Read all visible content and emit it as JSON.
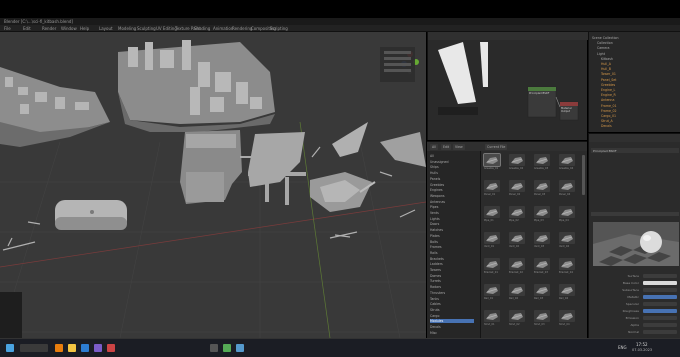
{
  "window": {
    "title": "Blender [C:\\...\\sci-fi_kitbash.blend]"
  },
  "menus": [
    "File",
    "Edit",
    "Render",
    "Window",
    "Help",
    "Layout",
    "Modeling",
    "Sculpting",
    "UV Editing",
    "Texture Paint",
    "Shading",
    "Animation",
    "Rendering",
    "Compositing",
    "Scripting"
  ],
  "viewport": {
    "header_buttons": [
      "Object Mode",
      "View",
      "Select",
      "Add",
      "Object"
    ]
  },
  "node_editor": {
    "tabs": [
      "Object",
      "View",
      "Select",
      "Add",
      "Node"
    ],
    "node_labels": [
      "Principled BSDF",
      "Material Output"
    ]
  },
  "asset_browser": {
    "tabs": [
      "All",
      "Edit",
      "View"
    ],
    "library": "Current File",
    "tree": [
      "All",
      "Unassigned",
      "Ships",
      "Hulls",
      "Panels",
      "Greebles",
      "Engines",
      "Weapons",
      "Antennas",
      "Pipes",
      "Vents",
      "Lights",
      "Doors",
      "Hatches",
      "Plates",
      "Bolts",
      "Frames",
      "Rails",
      "Brackets",
      "Ladders",
      "Towers",
      "Domes",
      "Turrets",
      "Radars",
      "Thrusters",
      "Tanks",
      "Cables",
      "Struts",
      "Cargo",
      "Modules",
      "Decals",
      "Misc"
    ],
    "selected_tree_index": 29,
    "thumbnails": [
      "Greeble_01",
      "Greeble_02",
      "Greeble_03",
      "Greeble_04",
      "Panel_01",
      "Panel_02",
      "Panel_03",
      "Panel_04",
      "Pipe_01",
      "Pipe_02",
      "Pipe_03",
      "Pipe_04",
      "Vent_01",
      "Vent_02",
      "Vent_03",
      "Vent_04",
      "Bracket_01",
      "Bracket_02",
      "Bracket_03",
      "Bracket_04",
      "Rail_01",
      "Rail_02",
      "Rail_03",
      "Rail_04",
      "Strut_01",
      "Strut_02",
      "Strut_03",
      "Strut_04"
    ]
  },
  "outliner": {
    "title": "Scene Collection",
    "rows": [
      "Scene Collection",
      "Collection",
      "Camera",
      "Light",
      "Kitbash",
      "Hull_A",
      "Hull_B",
      "Tower_01",
      "Panel_Set",
      "Greebles",
      "Engine_L",
      "Engine_R",
      "Antenna",
      "Frame_01",
      "Frame_02",
      "Cargo_01",
      "Strut_A",
      "Decals"
    ]
  },
  "properties": {
    "material_name": "Principled BSDF",
    "labels": [
      "Surface",
      "Base Color",
      "Subsurface",
      "Metallic",
      "Specular",
      "Roughness",
      "Emission",
      "Alpha",
      "Normal"
    ]
  },
  "taskbar": {
    "clock": "17:52",
    "date": "07.03.2023",
    "lang": "ENG"
  },
  "colors": {
    "viewport_bg": "#393939",
    "accent_blue": "#4772b3",
    "mesh_grey": "#9a9a9a"
  }
}
